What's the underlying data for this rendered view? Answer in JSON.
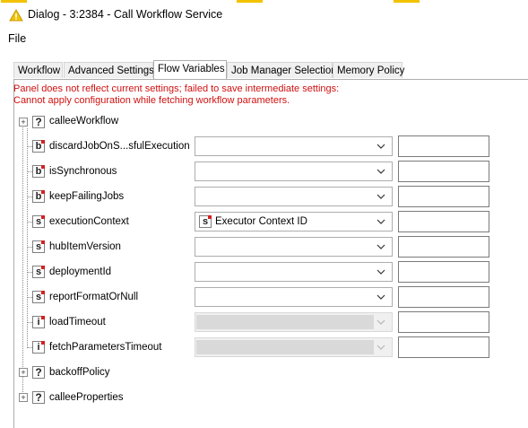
{
  "window": {
    "title": "Dialog - 3:2384 - Call Workflow Service",
    "accent_color": "#f2c200",
    "title_icon": "warning-triangle-icon"
  },
  "menu": {
    "file": "File"
  },
  "tabs": [
    {
      "label": "Workflow",
      "selected": false
    },
    {
      "label": "Advanced Settings",
      "selected": false
    },
    {
      "label": "Flow Variables",
      "selected": true
    },
    {
      "label": "Job Manager Selection",
      "selected": false
    },
    {
      "label": "Memory Policy",
      "selected": false
    }
  ],
  "errors": {
    "line1": "Panel does not reflect current settings; failed to save intermediate settings:",
    "line2": "Cannot apply configuration while fetching workflow parameters.",
    "color": "#d01010"
  },
  "tree": {
    "calleeWorkflow": {
      "label": "calleeWorkflow",
      "type": "?",
      "expander": "+"
    },
    "rows": [
      {
        "label": "discardJobOnS...sfulExecution",
        "type": "b",
        "combo_value": "",
        "enabled": true
      },
      {
        "label": "isSynchronous",
        "type": "b",
        "combo_value": "",
        "enabled": true
      },
      {
        "label": "keepFailingJobs",
        "type": "b",
        "combo_value": "",
        "enabled": true
      },
      {
        "label": "executionContext",
        "type": "s",
        "combo_value": "Executor Context ID",
        "combo_icon": "s",
        "enabled": true
      },
      {
        "label": "hubItemVersion",
        "type": "s",
        "combo_value": "",
        "enabled": true
      },
      {
        "label": "deploymentId",
        "type": "s",
        "combo_value": "",
        "enabled": true
      },
      {
        "label": "reportFormatOrNull",
        "type": "s",
        "combo_value": "",
        "enabled": true
      },
      {
        "label": "loadTimeout",
        "type": "i",
        "combo_value": "",
        "enabled": false
      },
      {
        "label": "fetchParametersTimeout",
        "type": "i",
        "combo_value": "",
        "enabled": false
      }
    ],
    "backoffPolicy": {
      "label": "backoffPolicy",
      "type": "?",
      "expander": "+"
    },
    "calleeProperties": {
      "label": "calleeProperties",
      "type": "?",
      "expander": "+"
    }
  }
}
